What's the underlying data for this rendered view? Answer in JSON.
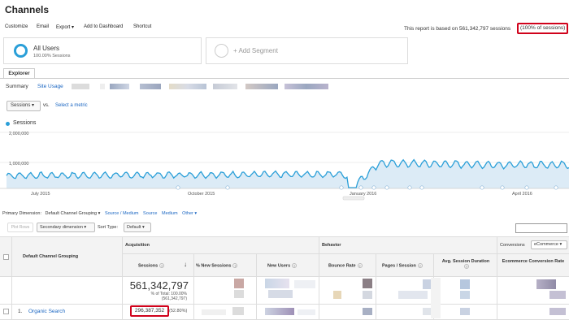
{
  "title": "Channels",
  "toolbar": {
    "customize": "Customize",
    "email": "Email",
    "export": "Export ▾",
    "add_to_dashboard": "Add to Dashboard",
    "shortcut": "Shortcut"
  },
  "report_note": "This report is based on 561,342,797 sessions",
  "report_pct": "(100% of sessions)",
  "segments": {
    "all_users": "All Users",
    "all_users_sub": "100.00% Sessions",
    "add_segment": "+ Add Segment"
  },
  "tabs": {
    "explorer": "Explorer"
  },
  "summary": {
    "label": "Summary",
    "site_usage": "Site Usage"
  },
  "metric": {
    "selected": "Sessions ▾",
    "vs": "vs.",
    "select_metric": "Select a metric"
  },
  "chart_data": {
    "type": "line",
    "title": "",
    "series": [
      {
        "name": "Sessions"
      }
    ],
    "ylabel": "",
    "yticks": [
      "2,000,000",
      "1,000,000"
    ],
    "ylim": [
      0,
      2400000
    ],
    "xticks": [
      "July 2015",
      "October 2015",
      "January 2016",
      "April 2016"
    ],
    "grid": true,
    "legend": "top-left",
    "color": "#2a9fd8"
  },
  "primary_dimension": {
    "label": "Primary Dimension:",
    "selected": "Default Channel Grouping ▾",
    "options": [
      "Source / Medium",
      "Source",
      "Medium",
      "Other ▾"
    ]
  },
  "table_controls": {
    "plot_rows": "Plot Rows",
    "secondary_dimension": "Secondary dimension ▾",
    "sort_type_label": "Sort Type:",
    "sort_type": "Default ▾"
  },
  "table": {
    "group_acquisition": "Acquisition",
    "group_behavior": "Behavior",
    "group_conversions": "Conversions",
    "conversions_select": "eCommerce ▾",
    "col_dimension": "Default Channel Grouping",
    "col_sessions": "Sessions",
    "col_new_sessions": "% New Sessions",
    "col_new_users": "New Users",
    "col_bounce_rate": "Bounce Rate",
    "col_pages_session": "Pages / Session",
    "col_avg_duration": "Avg. Session Duration",
    "col_ecommerce_rate": "Ecommerce Conversion Rate",
    "total_sessions": "561,342,797",
    "total_sub1": "% of Total: 100.00%",
    "total_sub2": "(561,342,797)",
    "rows": [
      {
        "num": "1.",
        "name": "Organic Search",
        "sessions": "296,387,352",
        "pct": "(52.80%)"
      }
    ]
  }
}
